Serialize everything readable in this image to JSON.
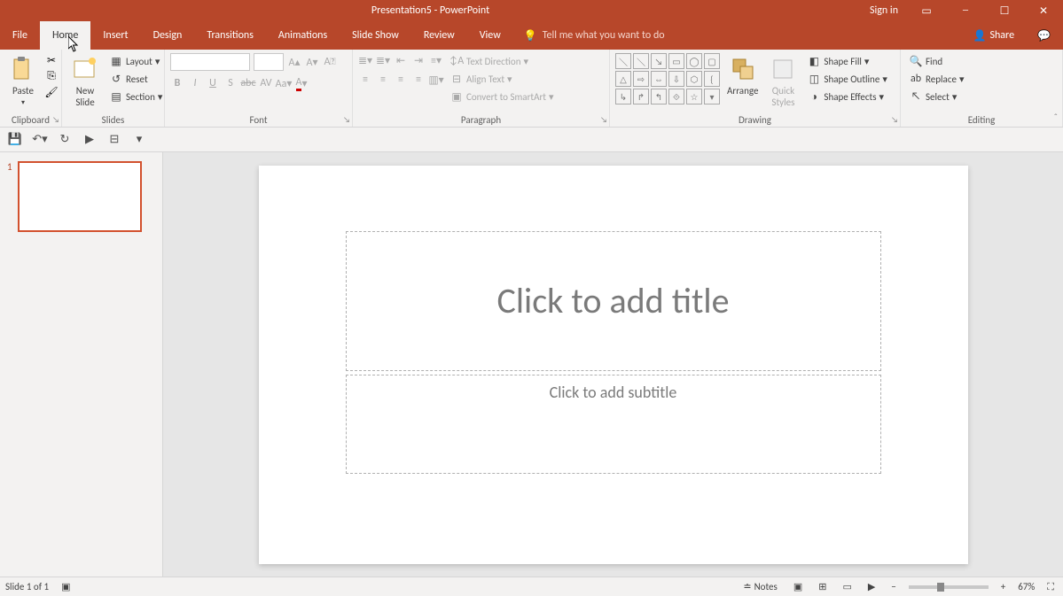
{
  "titlebar": {
    "title": "Presentation5 - PowerPoint",
    "signin": "Sign in"
  },
  "tabs": {
    "file": "File",
    "home": "Home",
    "insert": "Insert",
    "design": "Design",
    "transitions": "Transitions",
    "animations": "Animations",
    "slideshow": "Slide Show",
    "review": "Review",
    "view": "View",
    "tellme": "Tell me what you want to do",
    "share": "Share"
  },
  "ribbon": {
    "clipboard": {
      "label": "Clipboard",
      "paste": "Paste"
    },
    "slides": {
      "label": "Slides",
      "newslide": "New\nSlide",
      "layout": "Layout",
      "reset": "Reset",
      "section": "Section"
    },
    "font": {
      "label": "Font"
    },
    "paragraph": {
      "label": "Paragraph",
      "textdir": "Text Direction",
      "align": "Align Text",
      "smartart": "Convert to SmartArt"
    },
    "drawing": {
      "label": "Drawing",
      "arrange": "Arrange",
      "quickstyles": "Quick\nStyles",
      "fill": "Shape Fill",
      "outline": "Shape Outline",
      "effects": "Shape Effects"
    },
    "editing": {
      "label": "Editing",
      "find": "Find",
      "replace": "Replace",
      "select": "Select"
    }
  },
  "slide": {
    "title_placeholder": "Click to add title",
    "subtitle_placeholder": "Click to add subtitle",
    "thumb_num": "1"
  },
  "status": {
    "slidecount": "Slide 1 of 1",
    "notes": "Notes",
    "zoom": "67%"
  }
}
